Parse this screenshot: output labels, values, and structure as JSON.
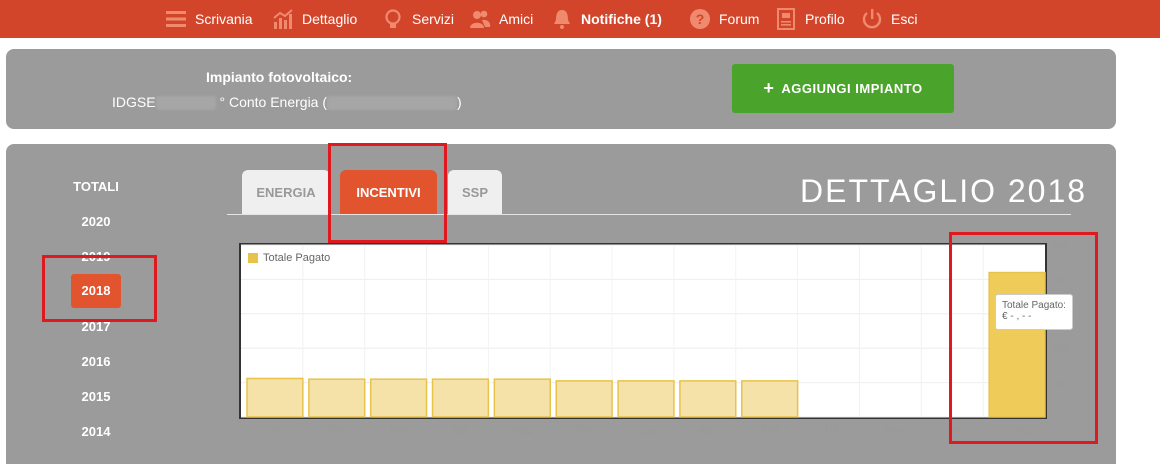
{
  "nav": {
    "items": [
      {
        "label": "Scrivania",
        "icon": "menu-icon",
        "bold": false
      },
      {
        "label": "Dettaglio",
        "icon": "chart-icon",
        "bold": false
      },
      {
        "label": "Servizi",
        "icon": "lightbulb-icon",
        "bold": false
      },
      {
        "label": "Amici",
        "icon": "users-icon",
        "bold": false
      },
      {
        "label": "Notifiche (1)",
        "icon": "bell-icon",
        "bold": true
      },
      {
        "label": "Forum",
        "icon": "question-icon",
        "bold": false
      },
      {
        "label": "Profilo",
        "icon": "profile-icon",
        "bold": false
      },
      {
        "label": "Esci",
        "icon": "power-icon",
        "bold": false
      }
    ]
  },
  "impianto": {
    "title": "Impianto fotovoltaico:",
    "value_prefix": "IDGSE",
    "value_middle": "° Conto Energia (",
    "value_suffix": ")",
    "add_button": "AGGIUNGI IMPIANTO"
  },
  "years": {
    "totali": "TOTALI",
    "list": [
      "2020",
      "2019",
      "2018",
      "2017",
      "2016",
      "2015",
      "2014"
    ],
    "active": "2018"
  },
  "tabs": [
    "ENERGIA",
    "INCENTIVI",
    "SSP"
  ],
  "active_tab": "INCENTIVI",
  "page_title": "DETTAGLIO 2018",
  "tooltip": {
    "title": "Totale Pagato:",
    "value": "€ - , - -"
  },
  "colors": {
    "nav": "#d2452a",
    "accent": "#e2542d",
    "green": "#4aa32a",
    "bar": "#f5e2a8",
    "bar_border": "#e8c34c",
    "bar_highlight": "#efcc5a",
    "annotation": "#e0191f"
  },
  "chart_data": {
    "type": "bar",
    "categories": [
      "Gen",
      "Feb",
      "Mar",
      "Apr",
      "Mag",
      "Giu",
      "Lug",
      "Ago",
      "Sett",
      "Ott",
      "Nov",
      "Dic",
      "Cong."
    ],
    "series": [
      {
        "name": "Totale Pagato",
        "values": [
          112,
          110,
          110,
          110,
          110,
          105,
          105,
          105,
          105,
          0,
          0,
          0,
          420
        ]
      }
    ],
    "ylim": [
      0,
      500
    ],
    "yticks": [
      0,
      100,
      200,
      300,
      400,
      500
    ],
    "highlight_index": 12,
    "grid": true,
    "legend": "top-left"
  }
}
